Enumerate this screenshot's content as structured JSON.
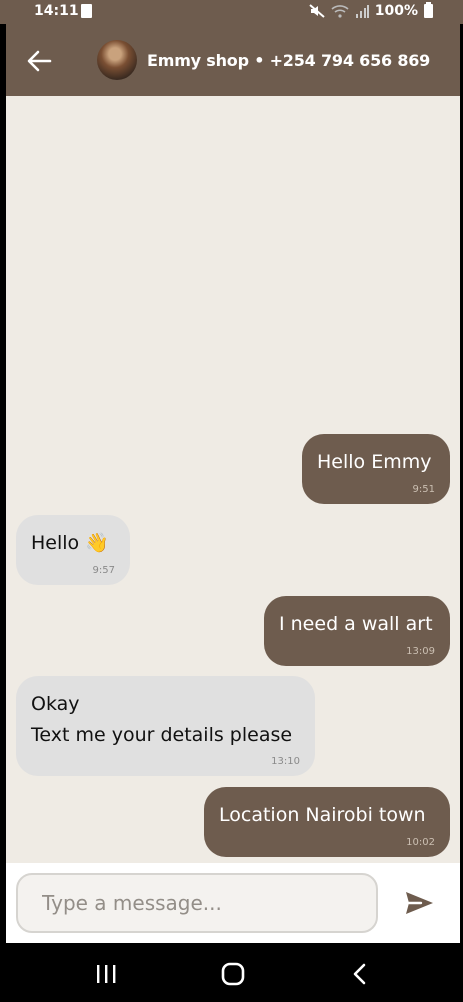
{
  "status_bar": {
    "time": "14:11",
    "battery": "100%",
    "icons": [
      "sim-card-icon",
      "mute-icon",
      "wifi-icon",
      "signal-icon",
      "battery-icon"
    ]
  },
  "header": {
    "title": "Emmy shop • +254 794 656 869",
    "back_icon": "arrow-left-icon"
  },
  "messages": [
    {
      "direction": "outgoing",
      "text": "Hello Emmy",
      "time": "9:51"
    },
    {
      "direction": "incoming",
      "text": "Hello 👋",
      "time": "9:57"
    },
    {
      "direction": "outgoing",
      "text": "I need a wall art",
      "time": "13:09"
    },
    {
      "direction": "incoming",
      "text": "Okay\nText me your details please",
      "time": "13:10"
    },
    {
      "direction": "outgoing",
      "text": "Location Nairobi town",
      "time": "10:02"
    }
  ],
  "composer": {
    "placeholder": "Type a message...",
    "value": "",
    "send_icon": "send-icon"
  },
  "nav": {
    "icons": [
      "recent-apps-icon",
      "home-icon",
      "back-icon"
    ]
  },
  "colors": {
    "primary": "#6e5c4e",
    "chat_background": "#efebe4",
    "incoming_bubble": "#e0e0e0"
  }
}
